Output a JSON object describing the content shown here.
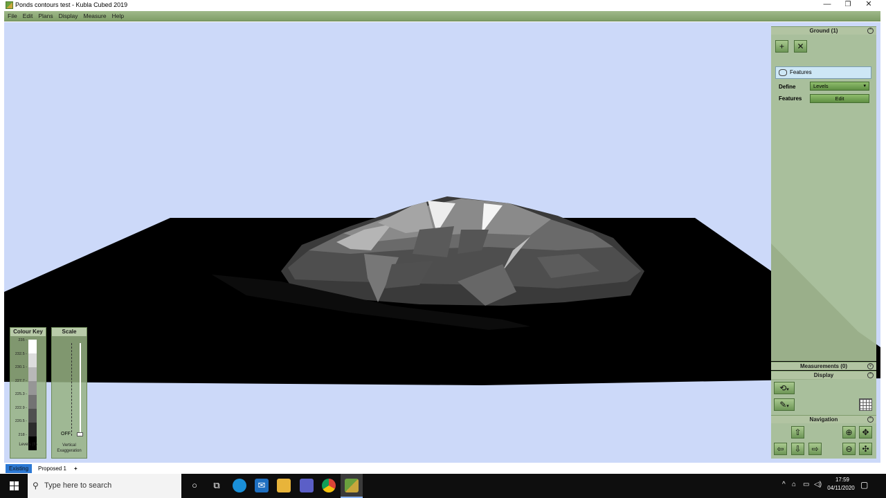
{
  "window": {
    "title": "Ponds contours test - Kubla Cubed 2019",
    "minimize": "—",
    "restore": "❐",
    "close": "✕"
  },
  "menu": [
    "File",
    "Edit",
    "Plans",
    "Display",
    "Measure",
    "Help"
  ],
  "panel": {
    "ground_header": "Ground (1)",
    "add_button": "+",
    "delete_button": "✕",
    "feature_item": "Features",
    "define_label": "Define",
    "define_value": "Levels",
    "features_label": "Features",
    "edit_button": "Edit",
    "measurements_header": "Measurements (0)",
    "display_header": "Display",
    "navigation_header": "Navigation"
  },
  "colour_key": {
    "title": "Colour Key",
    "labels": [
      "235",
      "232.5",
      "230.1",
      "227.7",
      "225.3",
      "222.9",
      "220.5",
      "218"
    ],
    "colors": [
      "#ffffff",
      "#dcdcdc",
      "#b8b8b8",
      "#969696",
      "#737373",
      "#505050",
      "#2d2d2d",
      "#000000"
    ],
    "footer": "Levels (ft)"
  },
  "scale": {
    "title": "Scale",
    "off_label": "OFF",
    "footer_line1": "Vertical",
    "footer_line2": "Exaggeration"
  },
  "tabs": {
    "existing": "Existing",
    "proposed": "Proposed 1",
    "add": "+"
  },
  "taskbar": {
    "search_placeholder": "Type here to search",
    "time": "17:59",
    "date": "04/11/2020"
  },
  "colors": {
    "sky": "#ccd9f9",
    "panel_green": "#a6bc94",
    "accent_blue": "#0078d7"
  }
}
